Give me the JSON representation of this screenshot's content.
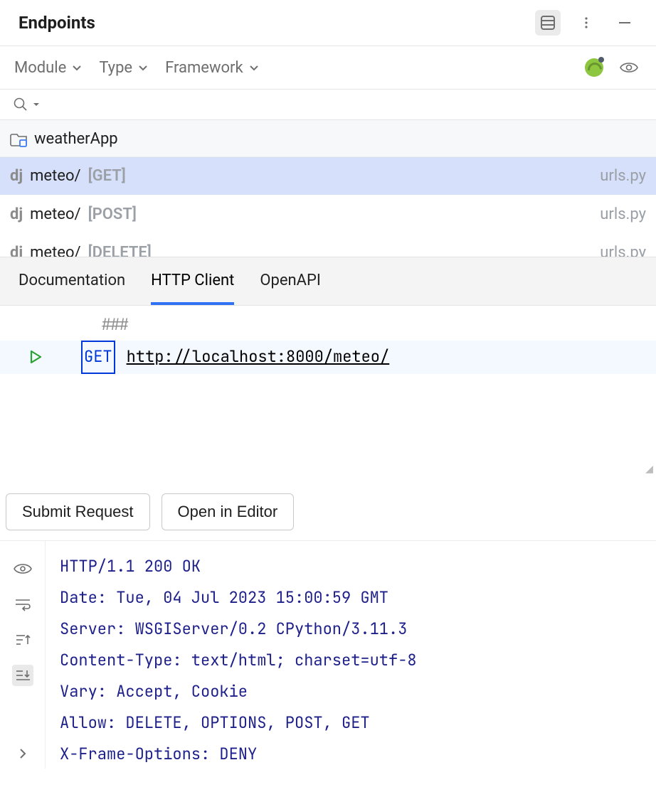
{
  "header": {
    "title": "Endpoints"
  },
  "filters": {
    "module": "Module",
    "type": "Type",
    "framework": "Framework"
  },
  "search": {
    "placeholder": ""
  },
  "tree": {
    "module_name": "weatherApp",
    "endpoints": [
      {
        "dj": "dj",
        "path": "meteo/",
        "method": "[GET]",
        "file": "urls.py",
        "selected": true
      },
      {
        "dj": "dj",
        "path": "meteo/",
        "method": "[POST]",
        "file": "urls.py",
        "selected": false
      },
      {
        "dj": "dj",
        "path": "meteo/",
        "method": "[DELETE]",
        "file": "urls.py",
        "selected": false
      }
    ]
  },
  "tabs": {
    "documentation": "Documentation",
    "http_client": "HTTP Client",
    "openapi": "OpenAPI"
  },
  "editor": {
    "comment": "###",
    "method": "GET",
    "url": "http://localhost:8000/meteo/"
  },
  "actions": {
    "submit": "Submit Request",
    "open_editor": "Open in Editor"
  },
  "response": {
    "lines": [
      "HTTP/1.1 200 OK",
      "Date: Tue, 04 Jul 2023 15:00:59 GMT",
      "Server: WSGIServer/0.2 CPython/3.11.3",
      "Content-Type: text/html; charset=utf-8",
      "Vary: Accept, Cookie",
      "Allow: DELETE, OPTIONS, POST, GET",
      "X-Frame-Options: DENY"
    ]
  }
}
